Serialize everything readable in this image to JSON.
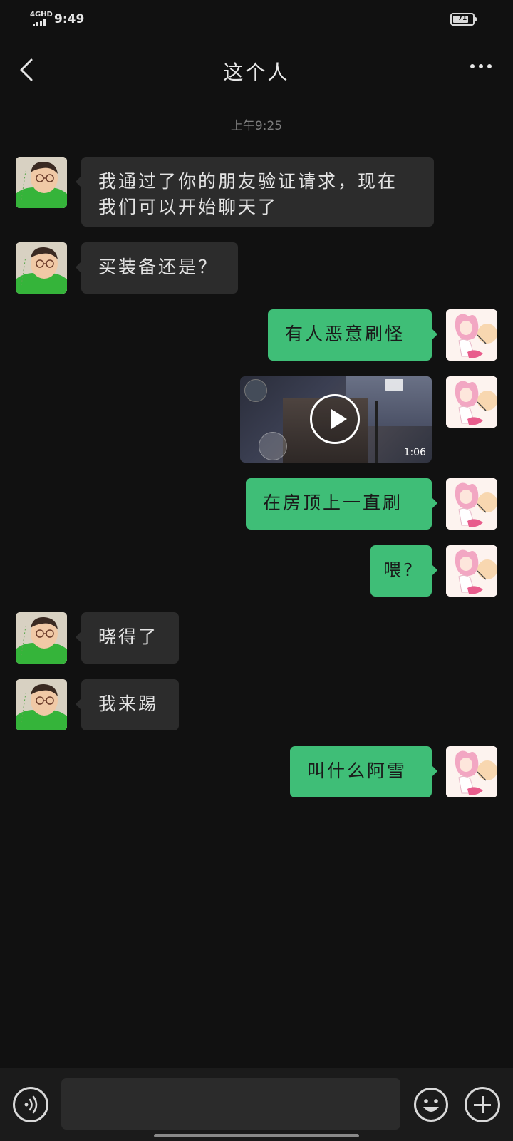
{
  "status_bar": {
    "network": "4GHD",
    "time": "9:49",
    "battery": "71"
  },
  "header": {
    "title": "这个人",
    "back_icon": "chevron-left-icon",
    "more_icon": "more-dots-icon"
  },
  "chat": {
    "timestamp": "上午9:25",
    "messages": [
      {
        "side": "in",
        "text": "我通过了你的朋友验证请求，现在我们可以开始聊天了"
      },
      {
        "side": "in",
        "text": "买装备还是？"
      },
      {
        "side": "out",
        "text": "有人恶意刷怪"
      },
      {
        "side": "out",
        "type": "video",
        "duration": "1:06"
      },
      {
        "side": "out",
        "text": "在房顶上一直刷"
      },
      {
        "side": "out",
        "text": "喂?"
      },
      {
        "side": "in",
        "text": "晓得了"
      },
      {
        "side": "in",
        "text": "我来踢"
      },
      {
        "side": "out",
        "text": "叫什么阿雪"
      }
    ]
  },
  "input_bar": {
    "voice_icon": "voice-icon",
    "input_value": "",
    "emoji_icon": "emoji-icon",
    "plus_icon": "plus-icon"
  }
}
